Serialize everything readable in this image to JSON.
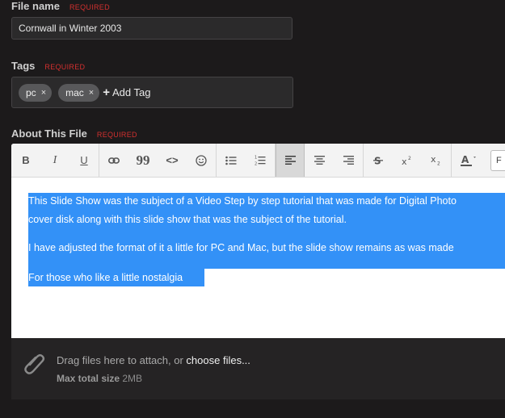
{
  "file_name": {
    "label": "File name",
    "required": "REQUIRED",
    "value": "Cornwall in Winter 2003"
  },
  "tags": {
    "label": "Tags",
    "required": "REQUIRED",
    "items": [
      {
        "label": "pc",
        "remove": "×"
      },
      {
        "label": "mac",
        "remove": "×"
      }
    ],
    "add_label": "Add Tag"
  },
  "about": {
    "label": "About This File",
    "required": "REQUIRED",
    "toolbar": {
      "bold": "B",
      "italic": "I",
      "underline": "U",
      "quote": "99",
      "code": "<>",
      "font_partial": "F"
    },
    "paragraphs": [
      "This Slide Show was the subject of a Video Step by step tutorial that was made for Digital Photo",
      "cover disk along with this slide show that was the subject of the tutorial.",
      "I have adjusted the format of it a little for PC and Mac, but the slide show remains as was made",
      "For those who like a little nostalgia"
    ]
  },
  "uploader": {
    "drag_prefix": "Drag files here to attach, or ",
    "choose_link": "choose files...",
    "max_label": "Max total size",
    "max_value": "2MB"
  },
  "colors": {
    "background": "#1c1a1b",
    "required": "#d2302f",
    "selection": "#3391f7",
    "chip": "#58585a"
  }
}
